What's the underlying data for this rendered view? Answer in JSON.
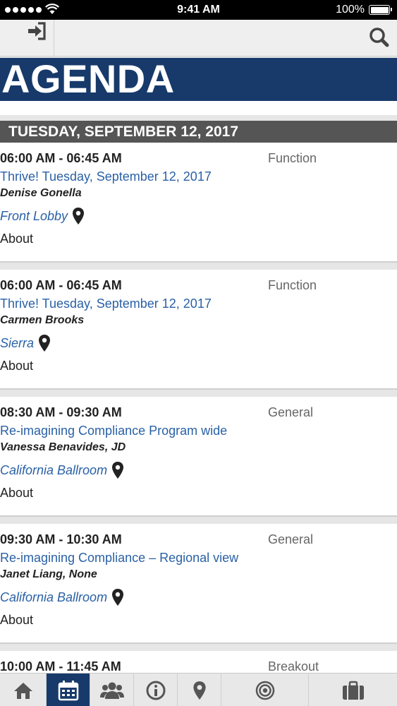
{
  "status_bar": {
    "time": "9:41 AM",
    "battery": "100%"
  },
  "page": {
    "title": "AGENDA"
  },
  "date_header": "TUESDAY, SEPTEMBER 12, 2017",
  "sessions": [
    {
      "time": "06:00 AM - 06:45 AM",
      "category": "Function",
      "title": "Thrive! Tuesday, September 12, 2017",
      "speaker": "Denise Gonella",
      "location": "Front Lobby",
      "about": "About"
    },
    {
      "time": "06:00 AM - 06:45 AM",
      "category": "Function",
      "title": "Thrive! Tuesday, September 12, 2017",
      "speaker": "Carmen Brooks",
      "location": "Sierra",
      "about": "About"
    },
    {
      "time": "08:30 AM - 09:30 AM",
      "category": "General",
      "title": "Re-imagining Compliance Program wide",
      "speaker": "Vanessa Benavides, JD",
      "location": "California Ballroom",
      "about": "About"
    },
    {
      "time": "09:30 AM - 10:30 AM",
      "category": "General",
      "title": "Re-imagining Compliance – Regional view",
      "speaker": "Janet Liang, None",
      "location": "California Ballroom",
      "about": "About"
    },
    {
      "time": "10:00 AM - 11:45 AM",
      "category": "Breakout"
    }
  ],
  "tabs": [
    {
      "icon": "home-icon"
    },
    {
      "icon": "calendar-icon",
      "active": true
    },
    {
      "icon": "people-icon"
    },
    {
      "icon": "info-icon"
    },
    {
      "icon": "map-pin-icon"
    },
    {
      "icon": "target-icon"
    },
    {
      "icon": "briefcase-icon"
    }
  ],
  "colors": {
    "brand": "#173a6b",
    "link": "#2a61a6",
    "date_header": "#555555"
  }
}
